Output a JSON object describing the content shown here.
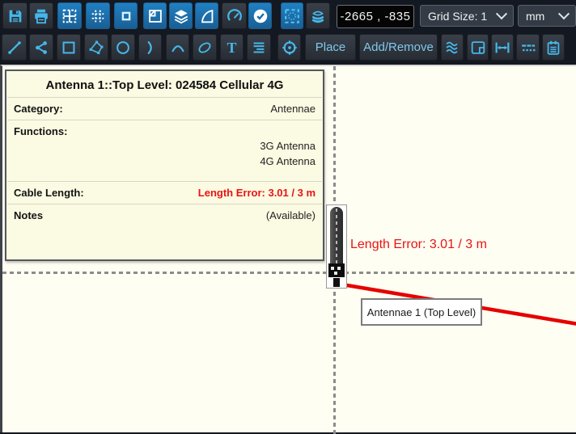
{
  "toolbar": {
    "coordinates": "-2665 , -835",
    "grid_size": "Grid Size: 1",
    "unit": "mm",
    "place": "Place",
    "add_remove": "Add/Remove",
    "text_tool": "T"
  },
  "canvas": {
    "length_error": "Length Error: 3.01 / 3 m",
    "antenna_label": "Antennae 1 (Top Level)"
  },
  "tooltip": {
    "title": "Antenna 1::Top Level: 024584 Cellular 4G",
    "category_label": "Category:",
    "category_value": "Antennae",
    "functions_label": "Functions:",
    "functions": [
      "3G Antenna",
      "4G Antenna"
    ],
    "cable_length_label": "Cable Length:",
    "cable_length_value": "Length Error: 3.01 / 3 m",
    "notes_label": "Notes",
    "notes_value": "(Available)"
  },
  "colors": {
    "accent_cyan": "#45b7ea",
    "active_blue": "#1d6ea9",
    "error_red": "#e81414",
    "canvas_bg": "#fffef2",
    "tooltip_bg": "#fbfae2"
  }
}
